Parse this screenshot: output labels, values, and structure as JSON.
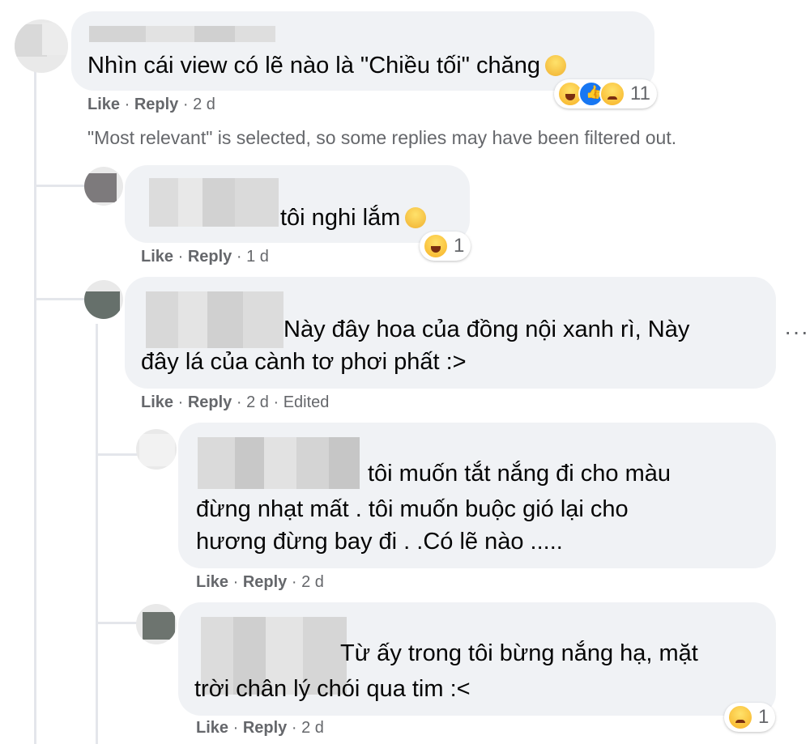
{
  "comments": [
    {
      "id": "c1",
      "text": "Nhìn cái view có lẽ nào là \"Chiều tối\" chăng",
      "actions": {
        "like": "Like",
        "sep1": "·",
        "reply": "Reply",
        "sep2": "·",
        "time": "2 d"
      },
      "reaction_count": "11",
      "reaction_icons": [
        "haha-icon",
        "like-icon",
        "sad-icon"
      ]
    },
    {
      "id": "c2",
      "text": "tôi nghi lắm",
      "actions": {
        "like": "Like",
        "sep1": "·",
        "reply": "Reply",
        "sep2": "·",
        "time": "1 d"
      },
      "reaction_count": "1",
      "reaction_icons": [
        "haha-icon"
      ]
    },
    {
      "id": "c3",
      "text_line1": "Này đây hoa của đồng nội xanh rì, Này",
      "text_line2": "đây lá của cành tơ phơi phất :>",
      "actions": {
        "like": "Like",
        "sep1": "·",
        "reply": "Reply",
        "sep2": "·",
        "time": "2 d",
        "sep3": "·",
        "edited": "Edited"
      }
    },
    {
      "id": "c4",
      "text_line1": "tôi muốn tắt nắng đi cho màu",
      "text_line2": "đừng nhạt mất . tôi muốn buộc gió lại cho",
      "text_line3": "hương đừng bay đi . .Có lẽ nào .....",
      "actions": {
        "like": "Like",
        "sep1": "·",
        "reply": "Reply",
        "sep2": "·",
        "time": "2 d"
      }
    },
    {
      "id": "c5",
      "text_line1": "Từ ấy trong tôi bừng nắng hạ, mặt",
      "text_line2": "trời chân lý chói qua tim :<",
      "actions": {
        "like": "Like",
        "sep1": "·",
        "reply": "Reply",
        "sep2": "·",
        "time": "2 d"
      },
      "reaction_count": "1",
      "reaction_icons": [
        "sad-icon"
      ]
    }
  ],
  "filter_note": "\"Most relevant\" is selected, so some replies may have been filtered out.",
  "more_options": "···",
  "colors": {
    "bubble": "#f0f2f5",
    "meta": "#65676b",
    "like_blue": "#1877f2",
    "haha_yellow": "#f7b125"
  }
}
